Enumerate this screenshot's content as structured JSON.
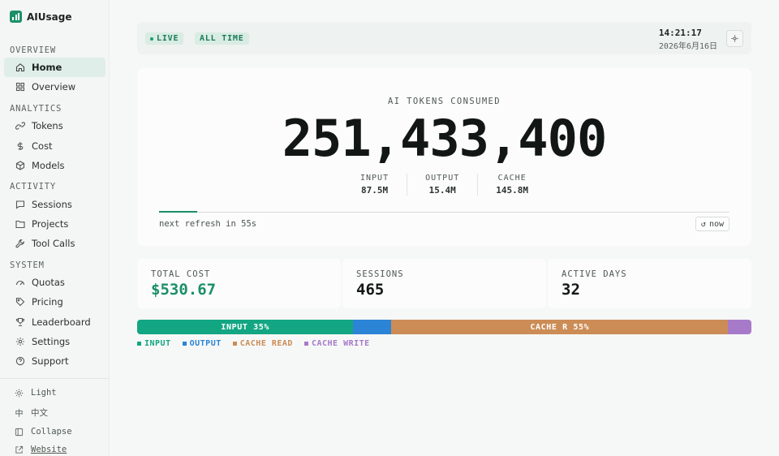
{
  "app": {
    "title": "AIUsage"
  },
  "sidebar": {
    "sections": [
      {
        "label": "OVERVIEW",
        "items": [
          {
            "label": "Home",
            "icon": "home-icon",
            "active": true
          },
          {
            "label": "Overview",
            "icon": "grid-icon"
          }
        ]
      },
      {
        "label": "ANALYTICS",
        "items": [
          {
            "label": "Tokens",
            "icon": "link-icon"
          },
          {
            "label": "Cost",
            "icon": "dollar-icon"
          },
          {
            "label": "Models",
            "icon": "cube-icon"
          }
        ]
      },
      {
        "label": "ACTIVITY",
        "items": [
          {
            "label": "Sessions",
            "icon": "chat-icon"
          },
          {
            "label": "Projects",
            "icon": "folder-icon"
          },
          {
            "label": "Tool Calls",
            "icon": "wrench-icon"
          }
        ]
      },
      {
        "label": "SYSTEM",
        "items": [
          {
            "label": "Quotas",
            "icon": "gauge-icon"
          },
          {
            "label": "Pricing",
            "icon": "tag-icon"
          },
          {
            "label": "Leaderboard",
            "icon": "trophy-icon"
          },
          {
            "label": "Settings",
            "icon": "gear-icon"
          },
          {
            "label": "Support",
            "icon": "help-icon"
          }
        ]
      }
    ],
    "footer": {
      "theme": "Light",
      "language_glyph": "中",
      "language": "中文",
      "collapse": "Collapse",
      "website": "Website"
    }
  },
  "header": {
    "live_label": "LIVE",
    "range_label": "ALL TIME",
    "time": "14:21:17",
    "date": "2026年6月16日"
  },
  "tokens": {
    "label": "AI TOKENS CONSUMED",
    "total": "251,433,400",
    "stats": [
      {
        "key": "INPUT",
        "value": "87.5M"
      },
      {
        "key": "OUTPUT",
        "value": "15.4M"
      },
      {
        "key": "CACHE",
        "value": "145.8M"
      }
    ],
    "refresh_progress": 0.067,
    "refresh_text": "next refresh in 55s",
    "now_icon": "↺",
    "now_label": "now"
  },
  "summary": [
    {
      "key": "TOTAL COST",
      "value": "$530.67",
      "accent": true
    },
    {
      "key": "SESSIONS",
      "value": "465"
    },
    {
      "key": "ACTIVE DAYS",
      "value": "32"
    }
  ],
  "composition": {
    "segments": [
      {
        "name": "INPUT",
        "label": "INPUT 35%",
        "share": 35.2,
        "color": "#13a683"
      },
      {
        "name": "OUTPUT",
        "label": "",
        "share": 6.2,
        "color": "#2b84d6"
      },
      {
        "name": "CACHE READ",
        "label": "CACHE R 55%",
        "share": 54.8,
        "color": "#cc8c55"
      },
      {
        "name": "CACHE WRITE",
        "label": "",
        "share": 3.8,
        "color": "#a77ac9"
      }
    ],
    "legend": [
      {
        "label": "INPUT",
        "color": "#13a683"
      },
      {
        "label": "OUTPUT",
        "color": "#2b84d6"
      },
      {
        "label": "CACHE READ",
        "color": "#cc8c55"
      },
      {
        "label": "CACHE WRITE",
        "color": "#a77ac9"
      }
    ]
  }
}
